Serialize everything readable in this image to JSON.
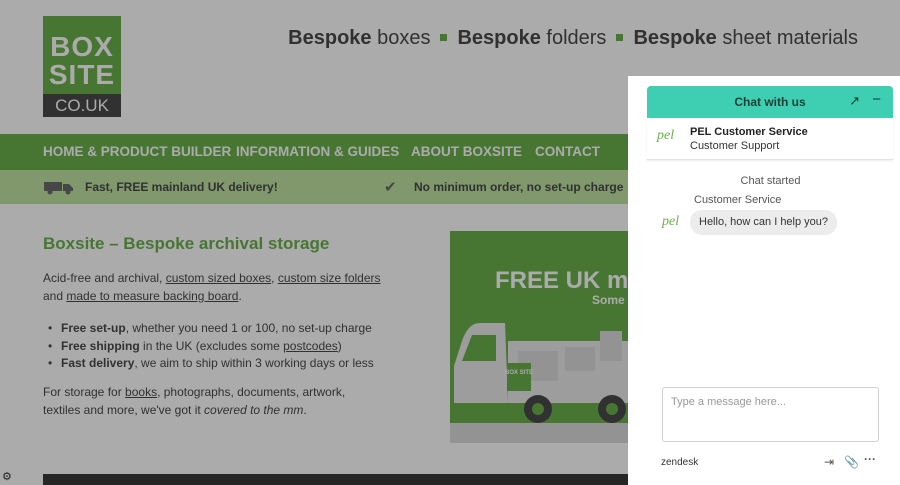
{
  "header": {
    "logo": {
      "line1": "BOX",
      "line2": "SITE",
      "line3": "CO.UK"
    },
    "tagline": [
      {
        "bold": "Bespoke",
        "rest": "boxes"
      },
      {
        "bold": "Bespoke",
        "rest": "folders"
      },
      {
        "bold": "Bespoke",
        "rest": "sheet materials"
      }
    ]
  },
  "nav": {
    "items": [
      "HOME & PRODUCT BUILDER",
      "INFORMATION & GUIDES",
      "ABOUT BOXSITE",
      "CONTACT"
    ]
  },
  "strip": {
    "delivery": "Fast, FREE mainland UK delivery!",
    "minimum": "No minimum order, no set-up charge"
  },
  "main": {
    "heading": "Boxsite – Bespoke archival storage",
    "intro": {
      "p1": "Acid-free and archival,",
      "link1": "custom sized boxes",
      "sep": ",",
      "link2": "custom size folders",
      "p2": "and",
      "link3": "made to measure backing board",
      "end": "."
    },
    "bullets": [
      {
        "bold": "Free set-up",
        "rest": ", whether you need 1 or 100, no set-up charge"
      },
      {
        "bold": "Free shipping",
        "rest": " in the UK (excludes some ",
        "link": "postcodes",
        "end": ")"
      },
      {
        "bold": "Fast delivery",
        "rest": ", we aim to ship within 3 working days or less"
      }
    ],
    "outro": {
      "p1": "For storage for",
      "link": "books",
      "p2": ", photographs, documents, artwork, textiles and more, we've got it",
      "em": "covered to the mm",
      "end": "."
    },
    "hero": {
      "headline": "FREE UK mai",
      "sub": "Some exc",
      "truck_text": "BOX SITE"
    }
  },
  "chat": {
    "title": "Chat with us",
    "agent": {
      "logo": "pel",
      "name": "PEL Customer Service",
      "role": "Customer Support"
    },
    "status": "Chat started",
    "sender": "Customer Service",
    "message": "Hello, how can I help you?",
    "input_placeholder": "Type a message here...",
    "brand": "zendesk"
  },
  "icons": {
    "popout": "popout-arrow-icon",
    "minimize": "minimize-icon",
    "end_chat": "end-chat-icon",
    "attach": "paperclip-icon",
    "more": "more-options-icon"
  },
  "colors": {
    "brand_green": "#6ab04c",
    "chat_teal": "#3ecfb2",
    "strip_green": "#bfe3a0",
    "text_dark": "#4a4a4a"
  }
}
